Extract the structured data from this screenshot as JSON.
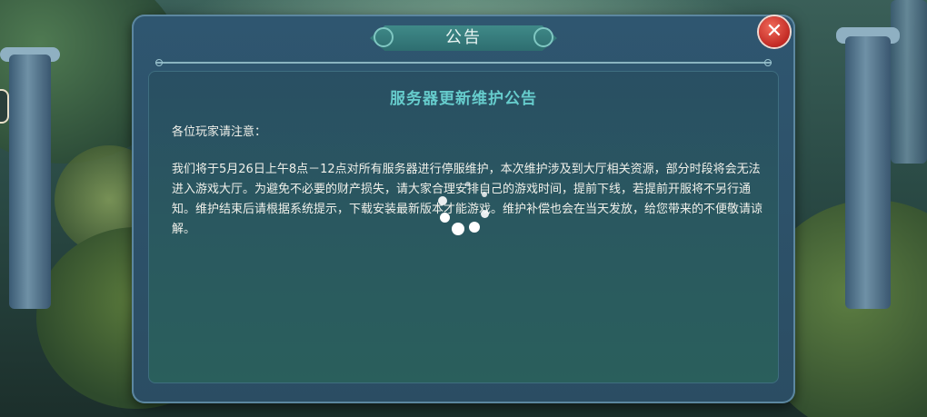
{
  "dialog": {
    "title": "公告",
    "close_label": "✕"
  },
  "notice": {
    "heading": "服务器更新维护公告",
    "greeting": "各位玩家请注意：",
    "body": "我们将于5月26日上午8点－12点对所有服务器进行停服维护，本次维护涉及到大厅相关资源，部分时段将会无法进入游戏大厅。为避免不必要的财产损失，请大家合理安排自己的游戏时间，提前下线，若提前开服将不另行通知。维护结束后请根据系统提示，下载安装最新版本才能游戏。维护补偿也会在当天发放，给您带来的不便敬请谅解。"
  },
  "icons": {
    "close": "close-icon",
    "loading": "loading-spinner-icon"
  },
  "colors": {
    "heading": "#66cccc",
    "close_button": "#c22a24",
    "panel": "#2a5a5f"
  }
}
